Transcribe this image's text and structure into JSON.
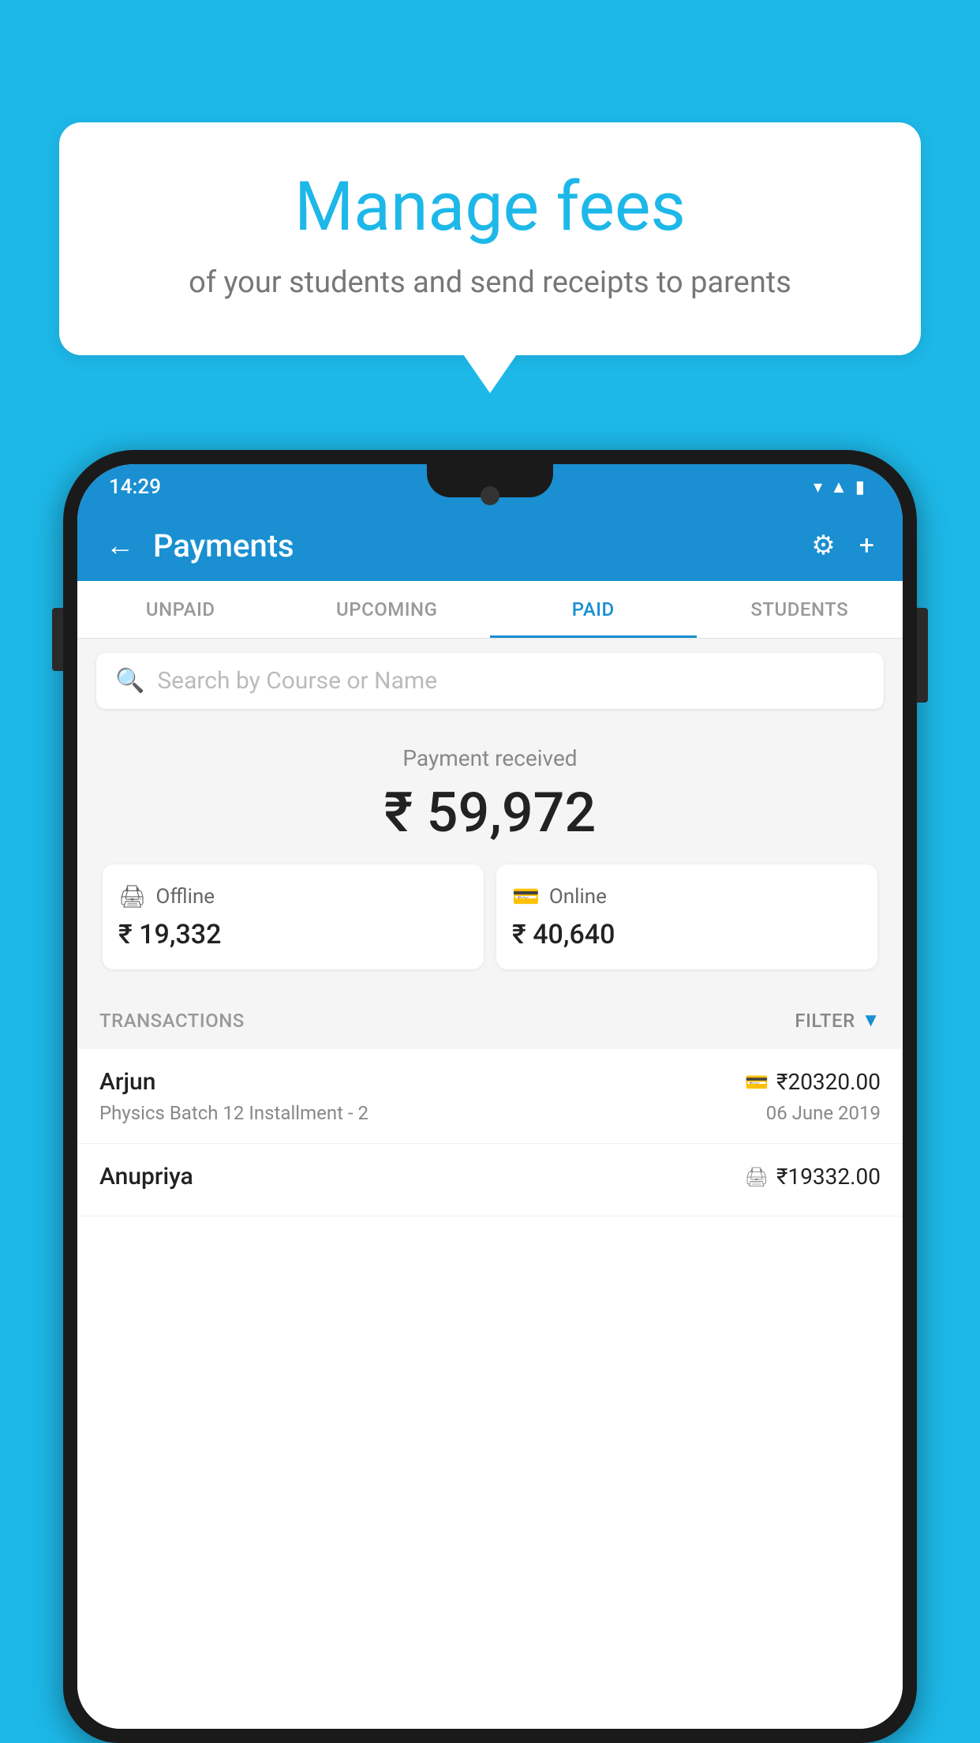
{
  "background_color": "#1db8e8",
  "speech_bubble": {
    "title": "Manage fees",
    "subtitle": "of your students and send receipts to parents"
  },
  "status_bar": {
    "time": "14:29",
    "wifi": "▾",
    "signal": "▲",
    "battery": "▮"
  },
  "header": {
    "back_label": "←",
    "title": "Payments",
    "settings_icon": "⚙",
    "add_icon": "+"
  },
  "tabs": [
    {
      "label": "UNPAID",
      "active": false
    },
    {
      "label": "UPCOMING",
      "active": false
    },
    {
      "label": "PAID",
      "active": true
    },
    {
      "label": "STUDENTS",
      "active": false
    }
  ],
  "search": {
    "placeholder": "Search by Course or Name"
  },
  "payment_summary": {
    "label": "Payment received",
    "total": "₹ 59,972",
    "offline": {
      "icon": "💳",
      "label": "Offline",
      "amount": "₹ 19,332"
    },
    "online": {
      "icon": "💳",
      "label": "Online",
      "amount": "₹ 40,640"
    }
  },
  "transactions_section": {
    "label": "TRANSACTIONS",
    "filter_label": "FILTER"
  },
  "transactions": [
    {
      "name": "Arjun",
      "type_icon": "💳",
      "amount": "₹20320.00",
      "course": "Physics Batch 12 Installment - 2",
      "date": "06 June 2019"
    },
    {
      "name": "Anupriya",
      "type_icon": "💵",
      "amount": "₹19332.00",
      "course": "",
      "date": ""
    }
  ]
}
